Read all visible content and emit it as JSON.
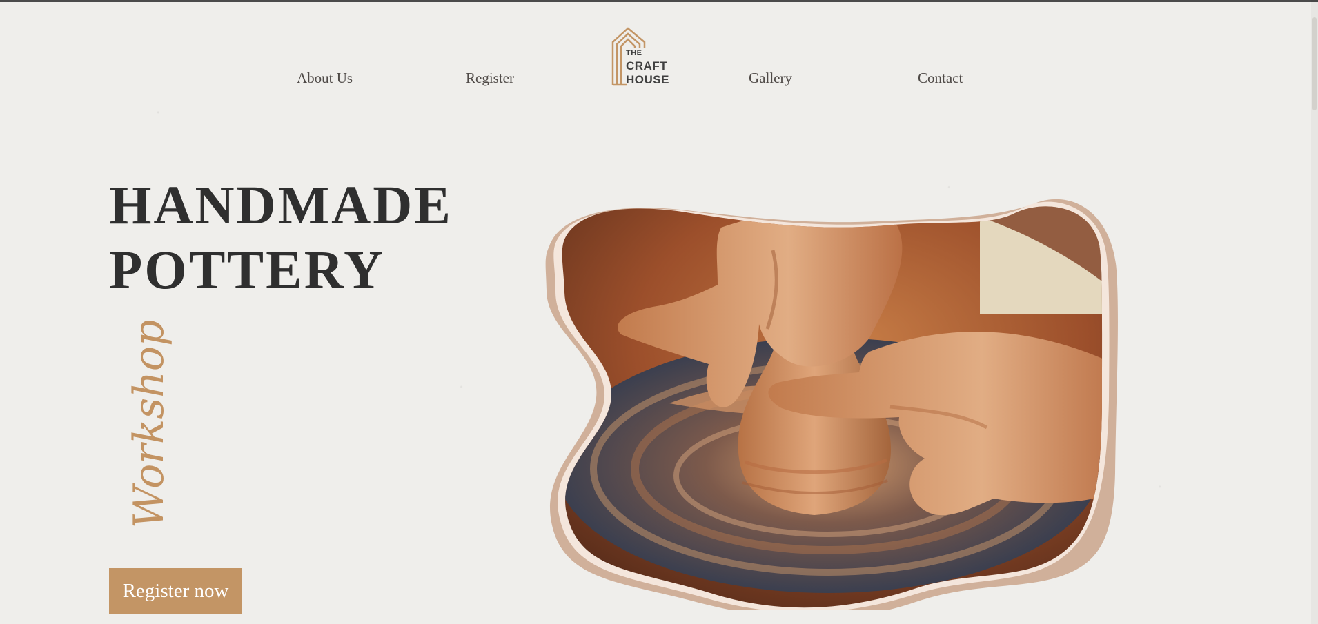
{
  "nav": {
    "items": [
      {
        "label": "About Us"
      },
      {
        "label": "Register"
      },
      {
        "label": "Gallery"
      },
      {
        "label": "Contact"
      }
    ],
    "logo": {
      "the": "THE",
      "craft": "CRAFT",
      "house": "HOUSE",
      "color": "#c39565",
      "text_color": "#3f3f3f"
    }
  },
  "hero": {
    "title_line_1": "HANDMADE",
    "title_line_2": "POTTERY",
    "script_text": "Workshop",
    "cta_label": "Register now",
    "accent": "#c39565",
    "title_color": "#2f2f2f"
  },
  "image": {
    "kind": "pottery-wheel-photo"
  }
}
